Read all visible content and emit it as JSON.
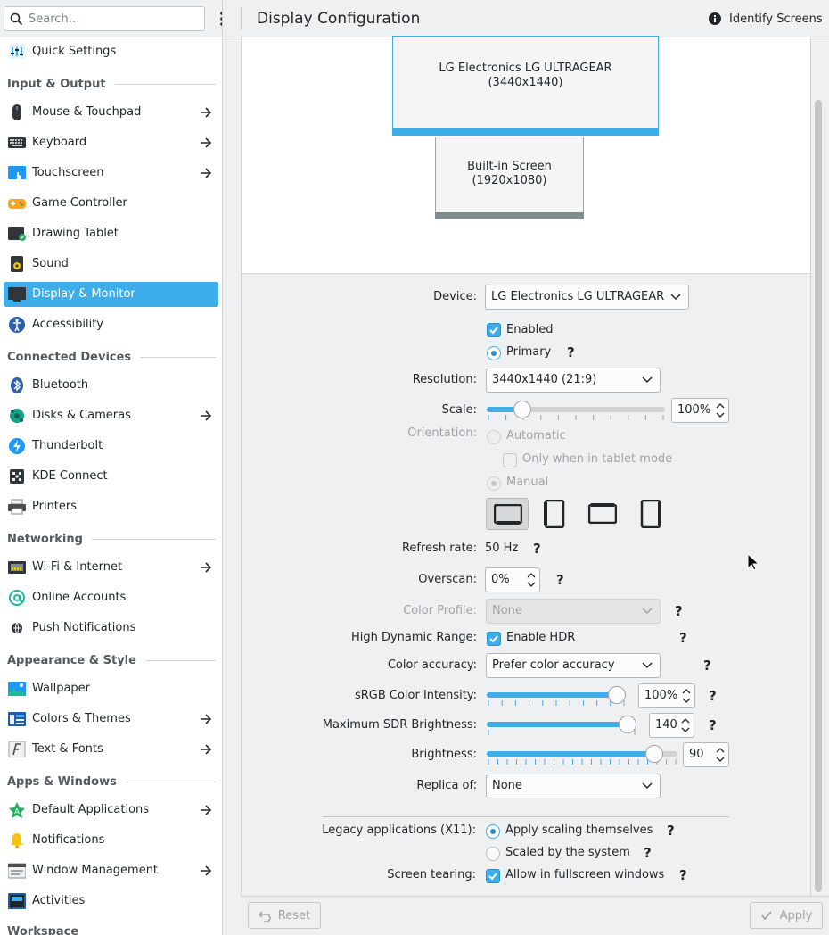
{
  "sidebar": {
    "search_placeholder": "Search…",
    "items": [
      {
        "label": "Quick Settings",
        "icon": "quick-settings-icon"
      },
      {
        "label": "Mouse & Touchpad",
        "icon": "mouse-icon"
      },
      {
        "label": "Keyboard",
        "icon": "keyboard-icon"
      },
      {
        "label": "Touchscreen",
        "icon": "touchscreen-icon"
      },
      {
        "label": "Game Controller",
        "icon": "gamepad-icon"
      },
      {
        "label": "Drawing Tablet",
        "icon": "tablet-icon"
      },
      {
        "label": "Sound",
        "icon": "speaker-icon"
      },
      {
        "label": "Display & Monitor",
        "icon": "monitor-icon"
      },
      {
        "label": "Accessibility",
        "icon": "accessibility-icon"
      },
      {
        "label": "Bluetooth",
        "icon": "bluetooth-icon"
      },
      {
        "label": "Disks & Cameras",
        "icon": "disks-icon"
      },
      {
        "label": "Thunderbolt",
        "icon": "thunderbolt-icon"
      },
      {
        "label": "KDE Connect",
        "icon": "kde-connect-icon"
      },
      {
        "label": "Printers",
        "icon": "printer-icon"
      },
      {
        "label": "Wi-Fi & Internet",
        "icon": "network-icon"
      },
      {
        "label": "Online Accounts",
        "icon": "online-accounts-icon"
      },
      {
        "label": "Push Notifications",
        "icon": "push-notifications-icon"
      },
      {
        "label": "Wallpaper",
        "icon": "wallpaper-icon"
      },
      {
        "label": "Colors & Themes",
        "icon": "colors-icon"
      },
      {
        "label": "Text & Fonts",
        "icon": "fonts-icon"
      },
      {
        "label": "Default Applications",
        "icon": "default-apps-icon"
      },
      {
        "label": "Notifications",
        "icon": "bell-icon"
      },
      {
        "label": "Window Management",
        "icon": "window-management-icon"
      },
      {
        "label": "Activities",
        "icon": "activities-icon"
      }
    ],
    "sections": {
      "input_output": "Input & Output",
      "connected_devices": "Connected Devices",
      "networking": "Networking",
      "appearance_style": "Appearance & Style",
      "apps_windows": "Apps & Windows",
      "workspace": "Workspace"
    },
    "active_color": "#3daee9"
  },
  "header": {
    "title": "Display Configuration",
    "identify_label": "Identify Screens"
  },
  "preview": {
    "screen1_name": "LG Electronics LG ULTRAGEAR",
    "screen1_res": "(3440x1440)",
    "screen2_name": "Built-in Screen",
    "screen2_res": "(1920x1080)"
  },
  "settings": {
    "device_label": "Device:",
    "device_value": "LG Electronics LG ULTRAGEAR",
    "enabled_label": "Enabled",
    "primary_label": "Primary",
    "resolution_label": "Resolution:",
    "resolution_value": "3440x1440 (21:9)",
    "scale_label": "Scale:",
    "scale_value": "100%",
    "scale_fraction": 0.2,
    "orientation_label": "Orientation:",
    "automatic_label": "Automatic",
    "tablet_mode_label": "Only when in tablet mode",
    "manual_label": "Manual",
    "refresh_label": "Refresh rate:",
    "refresh_value": "50 Hz",
    "overscan_label": "Overscan:",
    "overscan_value": "0%",
    "color_profile_label": "Color Profile:",
    "color_profile_value": "None",
    "hdr_label": "High Dynamic Range:",
    "hdr_checkbox_label": "Enable HDR",
    "color_accuracy_label": "Color accuracy:",
    "color_accuracy_value": "Prefer color accuracy",
    "srgb_label": "sRGB Color Intensity:",
    "srgb_value": "100%",
    "srgb_fraction": 1.0,
    "sdr_label": "Maximum SDR Brightness:",
    "sdr_value": "140",
    "sdr_fraction": 1.0,
    "brightness_label": "Brightness:",
    "brightness_value": "90",
    "brightness_fraction": 0.88,
    "replica_label": "Replica of:",
    "replica_value": "None",
    "legacy_label": "Legacy applications (X11):",
    "legacy_opt1": "Apply scaling themselves",
    "legacy_opt2": "Scaled by the system",
    "tearing_label": "Screen tearing:",
    "tearing_checkbox_label": "Allow in fullscreen windows",
    "help_glyph": "?"
  },
  "footer": {
    "reset_label": "Reset",
    "apply_label": "Apply"
  }
}
